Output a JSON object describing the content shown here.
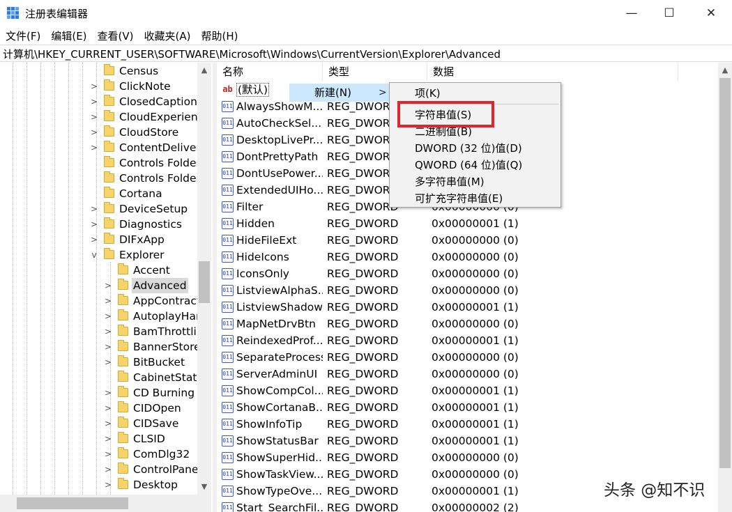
{
  "window": {
    "title": "注册表编辑器",
    "minimize_glyph": "—",
    "maximize_glyph": "☐",
    "close_glyph": "✕"
  },
  "menubar": [
    "文件(F)",
    "编辑(E)",
    "查看(V)",
    "收藏夹(A)",
    "帮助(H)"
  ],
  "address": "计算机\\HKEY_CURRENT_USER\\SOFTWARE\\Microsoft\\Windows\\CurrentVersion\\Explorer\\Advanced",
  "tree": {
    "items": [
      {
        "label": "Census",
        "expander": ""
      },
      {
        "label": "ClickNote",
        "expander": ">"
      },
      {
        "label": "ClosedCaptioni",
        "expander": ">"
      },
      {
        "label": "CloudExperienc",
        "expander": ">"
      },
      {
        "label": "CloudStore",
        "expander": ">"
      },
      {
        "label": "ContentDelivery",
        "expander": ">"
      },
      {
        "label": "Controls Folder",
        "expander": ""
      },
      {
        "label": "Controls Folder",
        "expander": ""
      },
      {
        "label": "Cortana",
        "expander": ""
      },
      {
        "label": "DeviceSetup",
        "expander": ">"
      },
      {
        "label": "Diagnostics",
        "expander": ">"
      },
      {
        "label": "DIFxApp",
        "expander": ">"
      },
      {
        "label": "Explorer",
        "expander": "v"
      },
      {
        "label": "Accent",
        "expander": ""
      },
      {
        "label": "Advanced",
        "expander": ">",
        "selected": true
      },
      {
        "label": "AppContract",
        "expander": ">"
      },
      {
        "label": "AutoplayHar",
        "expander": ">"
      },
      {
        "label": "BamThrottlin",
        "expander": ">"
      },
      {
        "label": "BannerStore",
        "expander": ">"
      },
      {
        "label": "BitBucket",
        "expander": ">"
      },
      {
        "label": "CabinetState",
        "expander": ""
      },
      {
        "label": "CD Burning",
        "expander": ">"
      },
      {
        "label": "CIDOpen",
        "expander": ">"
      },
      {
        "label": "CIDSave",
        "expander": ">"
      },
      {
        "label": "CLSID",
        "expander": ">"
      },
      {
        "label": "ComDlg32",
        "expander": ">"
      },
      {
        "label": "ControlPanel",
        "expander": ">"
      },
      {
        "label": "Desktop",
        "expander": ">"
      }
    ]
  },
  "list": {
    "headers": {
      "name": "名称",
      "type": "类型",
      "data": "数据"
    },
    "rows": [
      {
        "name": "(默认)",
        "type": "",
        "data": "",
        "icon": "ab"
      },
      {
        "name": "AlwaysShowM...",
        "type": "REG_DWORD",
        "data": "",
        "icon": "dword"
      },
      {
        "name": "AutoCheckSel...",
        "type": "REG_DWORD",
        "data": "",
        "icon": "dword"
      },
      {
        "name": "DesktopLivePr...",
        "type": "REG_DWORD",
        "data": "",
        "icon": "dword"
      },
      {
        "name": "DontPrettyPath",
        "type": "REG_DWORD",
        "data": "",
        "icon": "dword"
      },
      {
        "name": "DontUsePower...",
        "type": "REG_DWORD",
        "data": "",
        "icon": "dword"
      },
      {
        "name": "ExtendedUIHo...",
        "type": "REG_DWORD",
        "data": "",
        "icon": "dword"
      },
      {
        "name": "Filter",
        "type": "REG_DWORD",
        "data": "0x00000000 (0)",
        "icon": "dword"
      },
      {
        "name": "Hidden",
        "type": "REG_DWORD",
        "data": "0x00000001 (1)",
        "icon": "dword"
      },
      {
        "name": "HideFileExt",
        "type": "REG_DWORD",
        "data": "0x00000000 (0)",
        "icon": "dword"
      },
      {
        "name": "HideIcons",
        "type": "REG_DWORD",
        "data": "0x00000000 (0)",
        "icon": "dword"
      },
      {
        "name": "IconsOnly",
        "type": "REG_DWORD",
        "data": "0x00000000 (0)",
        "icon": "dword"
      },
      {
        "name": "ListviewAlphaS...",
        "type": "REG_DWORD",
        "data": "0x00000000 (0)",
        "icon": "dword"
      },
      {
        "name": "ListviewShadow",
        "type": "REG_DWORD",
        "data": "0x00000001 (1)",
        "icon": "dword"
      },
      {
        "name": "MapNetDrvBtn",
        "type": "REG_DWORD",
        "data": "0x00000000 (0)",
        "icon": "dword"
      },
      {
        "name": "ReindexedProf...",
        "type": "REG_DWORD",
        "data": "0x00000001 (1)",
        "icon": "dword"
      },
      {
        "name": "SeparateProcess",
        "type": "REG_DWORD",
        "data": "0x00000000 (0)",
        "icon": "dword"
      },
      {
        "name": "ServerAdminUI",
        "type": "REG_DWORD",
        "data": "0x00000000 (0)",
        "icon": "dword"
      },
      {
        "name": "ShowCompCol...",
        "type": "REG_DWORD",
        "data": "0x00000001 (1)",
        "icon": "dword"
      },
      {
        "name": "ShowCortanaB...",
        "type": "REG_DWORD",
        "data": "0x00000001 (1)",
        "icon": "dword"
      },
      {
        "name": "ShowInfoTip",
        "type": "REG_DWORD",
        "data": "0x00000001 (1)",
        "icon": "dword"
      },
      {
        "name": "ShowStatusBar",
        "type": "REG_DWORD",
        "data": "0x00000001 (1)",
        "icon": "dword"
      },
      {
        "name": "ShowSuperHid...",
        "type": "REG_DWORD",
        "data": "0x00000000 (0)",
        "icon": "dword"
      },
      {
        "name": "ShowTaskView...",
        "type": "REG_DWORD",
        "data": "0x00000000 (0)",
        "icon": "dword"
      },
      {
        "name": "ShowTypeOve...",
        "type": "REG_DWORD",
        "data": "0x00000001 (1)",
        "icon": "dword"
      },
      {
        "name": "Start_SearchFil...",
        "type": "REG_DWORD",
        "data": "0x00000002 (2)",
        "icon": "dword"
      }
    ]
  },
  "context_menu": {
    "new_label": "新建(N)",
    "new_arrow": ">",
    "submenu": [
      "项(K)",
      "字符串值(S)",
      "二进制值(B)",
      "DWORD (32 位)值(D)",
      "QWORD (64 位)值(Q)",
      "多字符串值(M)",
      "可扩充字符串值(E)"
    ],
    "highlight_color": "#e0262c"
  },
  "scroll": {
    "up": "▲",
    "down": "▼"
  },
  "watermark": "头条 @知不识"
}
